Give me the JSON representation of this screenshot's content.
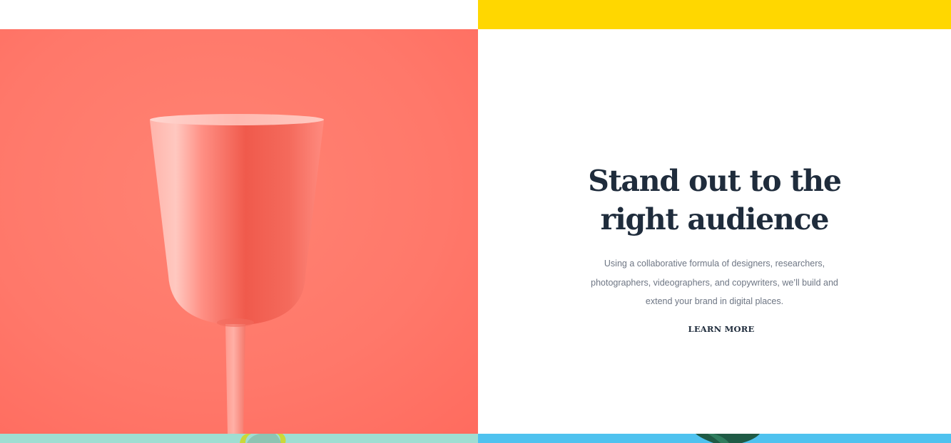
{
  "colors": {
    "top_band_yellow": "#ffd700",
    "hero_coral": "#ff7a6b",
    "headline": "#1f2c3c",
    "body_text": "#6e7684",
    "link_underline": "#f7c6c0",
    "bottom_mint": "#9fded2",
    "bottom_sky": "#4fc2ef"
  },
  "hero": {
    "image_subject": "coral-wine-glass-photo",
    "title_line_1": "Stand out to the",
    "title_line_2": "right audience",
    "body_line_1": "Using a collaborative formula of designers, researchers,",
    "body_line_2": "photographers, videographers, and copywriters, we’ll build and",
    "body_line_3": "extend your brand in digital places.",
    "cta_label": "LEARN MORE"
  }
}
